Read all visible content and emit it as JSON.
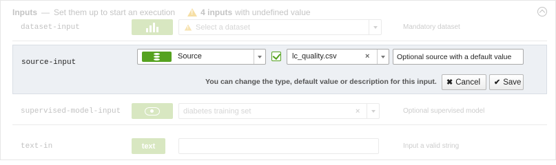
{
  "header": {
    "title": "Inputs",
    "dash": "—",
    "subtitle": "Set them up to start an execution",
    "warning_count": "4 inputs",
    "warning_text": "with undefined value"
  },
  "rows": {
    "dataset": {
      "name": "dataset-input",
      "placeholder": "Select a dataset",
      "description": "Mandatory dataset"
    },
    "source": {
      "name": "source-input",
      "type_label": "Source",
      "value": "lc_quality.csv",
      "clear": "×",
      "description": "Optional source with a default value",
      "hint": "You can change the type, default value or description for this input.",
      "cancel_label": "Cancel",
      "save_label": "Save",
      "cancel_icon": "✖",
      "save_icon": "✔"
    },
    "model": {
      "name": "supervised-model-input",
      "value": "diabetes training set",
      "clear": "×",
      "description": "Optional supervised model"
    },
    "text": {
      "name": "text-in",
      "type_label": "text",
      "description": "Input a valid string"
    }
  },
  "colors": {
    "accent_green": "#55a21f",
    "warning_orange": "#e6a400",
    "active_row_bg": "#edf0f4"
  }
}
